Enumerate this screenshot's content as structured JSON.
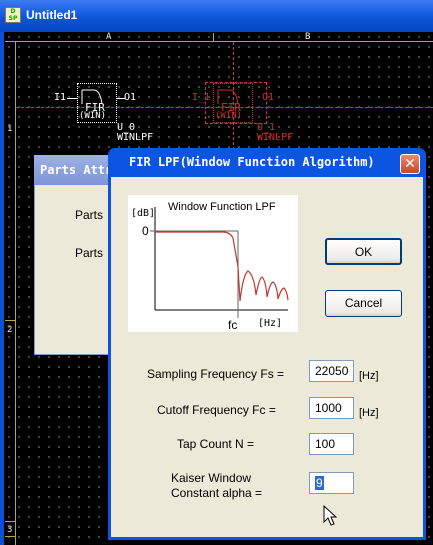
{
  "app": {
    "title": "Untitled1",
    "icon_text_top": "D",
    "icon_text_bottom": "SP"
  },
  "canvas": {
    "columns": [
      "A",
      "B"
    ],
    "rows": [
      "1",
      "2",
      "3"
    ],
    "blocks": [
      {
        "input": "I1",
        "output": "O1",
        "symbol_text": "FIR",
        "symbol_sub": "(WIN)",
        "instance": "U_0",
        "type": "WINLPF",
        "color": "#ffffff"
      },
      {
        "input": "I_1",
        "output": "O1",
        "symbol_text": "FIR",
        "symbol_sub": "(WIN)",
        "instance": "U_1",
        "type": "WINLPF",
        "color": "#d62a2a"
      }
    ]
  },
  "parts_dialog": {
    "title": "Parts Attr",
    "labels": [
      "Parts",
      "Parts"
    ]
  },
  "fir_dialog": {
    "title": "FIR LPF(Window Function Algorithm)",
    "graph": {
      "title": "Window Function LPF",
      "y_unit": "[dB]",
      "y_zero": "0",
      "x_marker": "fc",
      "x_unit": "[Hz]"
    },
    "ok_label": "OK",
    "cancel_label": "Cancel",
    "fields": {
      "fs_label": "Sampling Frequency Fs =",
      "fs_value": "22050",
      "fs_unit": "[Hz]",
      "fc_label": "Cutoff Frequency Fc =",
      "fc_value": "1000",
      "fc_unit": "[Hz]",
      "tap_label": "Tap Count N =",
      "tap_value": "100",
      "kaiser_label_line1": "Kaiser Window",
      "kaiser_label_line2": "Constant alpha =",
      "kaiser_value": "9"
    }
  },
  "colors": {
    "titlebar": "#0a55d8",
    "dialog_bg": "#ece9d8",
    "curve": "#c0392b",
    "selection": "#316ac5"
  }
}
